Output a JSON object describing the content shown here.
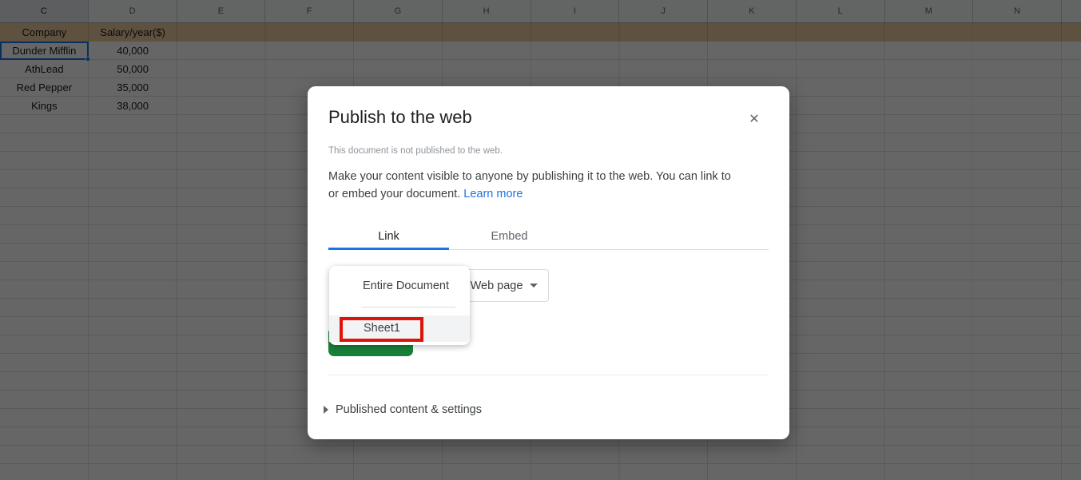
{
  "sheet": {
    "columns": [
      "C",
      "D",
      "E",
      "F",
      "G",
      "H",
      "I",
      "J",
      "K",
      "L",
      "M",
      "N"
    ],
    "header_row": {
      "company": "Company",
      "salary": "Salary/year($)"
    },
    "rows": [
      {
        "company": "Dunder Mifflin",
        "salary": "40,000"
      },
      {
        "company": "AthLead",
        "salary": "50,000"
      },
      {
        "company": "Red Pepper",
        "salary": "35,000"
      },
      {
        "company": "Kings",
        "salary": "38,000"
      }
    ],
    "selected_cell": "C2"
  },
  "dialog": {
    "title": "Publish to the web",
    "close_icon": "✕",
    "status": "This document is not published to the web.",
    "desc_line1": "Make your content visible to anyone by publishing it to the web. You can link to",
    "desc_line2": "or embed your document.",
    "learn_more": "Learn more",
    "tabs": [
      {
        "label": "Link",
        "active": true
      },
      {
        "label": "Embed",
        "active": false
      }
    ],
    "dropdown_menu": {
      "items": [
        {
          "label": "Entire Document",
          "highlighted": false
        },
        {
          "label": "Sheet1",
          "highlighted": true
        }
      ]
    },
    "format_select": {
      "value": "Web page"
    },
    "published_section_label": "Published content & settings"
  },
  "colors": {
    "accent_blue": "#1a73e8",
    "annotation_red": "#dd1508",
    "publish_green": "#188038",
    "header_row_tan": "#edcba0",
    "overlay": "rgba(0,0,0,0.6)"
  }
}
